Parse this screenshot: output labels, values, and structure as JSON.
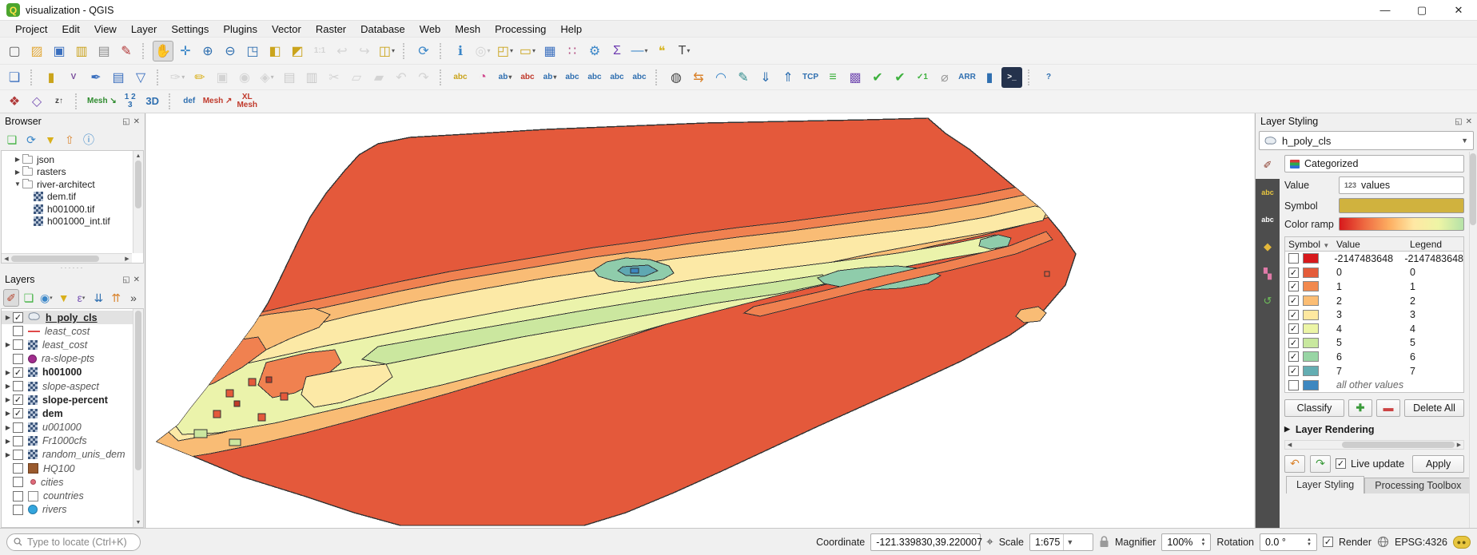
{
  "window": {
    "title": "visualization - QGIS"
  },
  "menu": [
    "Project",
    "Edit",
    "View",
    "Layer",
    "Settings",
    "Plugins",
    "Vector",
    "Raster",
    "Database",
    "Web",
    "Mesh",
    "Processing",
    "Help"
  ],
  "toolbar1": [
    {
      "name": "new-project",
      "glyph": "▢",
      "color": "#5f5f5f"
    },
    {
      "name": "open-project",
      "glyph": "▨",
      "color": "#e2a93b"
    },
    {
      "name": "save-project",
      "glyph": "▣",
      "color": "#3a6fbe"
    },
    {
      "name": "new-print-layout",
      "glyph": "▥",
      "color": "#c9a21d"
    },
    {
      "name": "show-layout-manager",
      "glyph": "▤",
      "color": "#8a8a8a"
    },
    {
      "name": "style-manager",
      "glyph": "✎",
      "color": "#b23737"
    },
    {
      "sep": true
    },
    {
      "name": "pan-map",
      "glyph": "✋",
      "color": "#4a4a4a",
      "active": true
    },
    {
      "name": "pan-to-selection",
      "glyph": "✛",
      "color": "#3a86c8"
    },
    {
      "name": "zoom-in",
      "glyph": "⊕",
      "color": "#2f6fb0"
    },
    {
      "name": "zoom-out",
      "glyph": "⊖",
      "color": "#2f6fb0"
    },
    {
      "name": "zoom-full",
      "glyph": "◳",
      "color": "#2f6fb0"
    },
    {
      "name": "zoom-to-layer",
      "glyph": "◧",
      "color": "#caa41c"
    },
    {
      "name": "zoom-to-selection",
      "glyph": "◩",
      "color": "#caa41c"
    },
    {
      "name": "zoom-native",
      "text": "1:1",
      "color": "#9a9a9a",
      "disabled": true
    },
    {
      "name": "zoom-last",
      "glyph": "↩",
      "color": "#9a9a9a",
      "disabled": true
    },
    {
      "name": "zoom-next",
      "glyph": "↪",
      "color": "#9a9a9a",
      "disabled": true
    },
    {
      "name": "new-map-view",
      "glyph": "◫",
      "color": "#caa41c",
      "caret": true
    },
    {
      "sep": true
    },
    {
      "name": "refresh-map",
      "glyph": "⟳",
      "color": "#3a86c8"
    },
    {
      "sep": true
    },
    {
      "name": "identify-features",
      "glyph": "ℹ",
      "color": "#3a86c8"
    },
    {
      "name": "run-feature-action",
      "glyph": "◎",
      "color": "#9a9a9a",
      "disabled": true,
      "caret": true
    },
    {
      "name": "select-features",
      "glyph": "◰",
      "color": "#caa41c",
      "caret": true
    },
    {
      "name": "deselect-features",
      "glyph": "▭",
      "color": "#caa41c",
      "caret": true
    },
    {
      "name": "open-attribute-table",
      "glyph": "▦",
      "color": "#3a6fbe"
    },
    {
      "name": "field-calculator",
      "glyph": "∷",
      "color": "#b24a7e"
    },
    {
      "name": "processing-options",
      "glyph": "⚙",
      "color": "#3a86c8"
    },
    {
      "name": "statistics-summary",
      "glyph": "Σ",
      "color": "#6d3bb0"
    },
    {
      "name": "measure",
      "glyph": "―",
      "color": "#3a86c8",
      "caret": true
    },
    {
      "name": "map-tips",
      "glyph": "❝",
      "color": "#d8b626"
    },
    {
      "name": "text-annotation",
      "glyph": "T",
      "color": "#444444",
      "caret": true
    }
  ],
  "toolbar2": [
    {
      "name": "data-source-manager",
      "glyph": "❏",
      "color": "#3a6fbe"
    },
    {
      "sep": true
    },
    {
      "name": "new-geopackage-layer",
      "glyph": "▮",
      "color": "#caa41c"
    },
    {
      "name": "new-shapefile-layer",
      "text": "V",
      "color": "#7a4f9d"
    },
    {
      "name": "new-scratch-layer",
      "glyph": "✒",
      "color": "#3a6fbe"
    },
    {
      "name": "new-mesh-layer",
      "glyph": "▤",
      "color": "#3a6fbe"
    },
    {
      "name": "new-gpx-layer",
      "glyph": "▽",
      "color": "#3a6fbe"
    },
    {
      "sep": true
    },
    {
      "name": "current-edits",
      "glyph": "✑",
      "color": "#9a9a9a",
      "disabled": true,
      "caret": true
    },
    {
      "name": "toggle-editing",
      "glyph": "✏",
      "color": "#d9b01c"
    },
    {
      "name": "save-layer-edits",
      "glyph": "▣",
      "color": "#9a9a9a",
      "disabled": true
    },
    {
      "name": "add-feature",
      "glyph": "◉",
      "color": "#9a9a9a",
      "disabled": true
    },
    {
      "name": "vertex-tool",
      "glyph": "◈",
      "color": "#9a9a9a",
      "disabled": true,
      "caret": true
    },
    {
      "name": "modify-attributes",
      "glyph": "▤",
      "color": "#b27777",
      "disabled": true
    },
    {
      "name": "delete-selected",
      "glyph": "▥",
      "color": "#c66a6a",
      "disabled": true
    },
    {
      "name": "cut-features",
      "glyph": "✂",
      "color": "#9a9a9a",
      "disabled": true
    },
    {
      "name": "copy-features",
      "glyph": "▱",
      "color": "#9a9a9a",
      "disabled": true
    },
    {
      "name": "paste-features",
      "glyph": "▰",
      "color": "#9a9a9a",
      "disabled": true
    },
    {
      "name": "undo",
      "glyph": "↶",
      "color": "#9a9a9a",
      "disabled": true
    },
    {
      "name": "redo",
      "glyph": "↷",
      "color": "#9a9a9a",
      "disabled": true
    },
    {
      "sep": true
    },
    {
      "name": "layer-labeling-options",
      "text": "abc",
      "color": "#caa41c"
    },
    {
      "name": "layer-diagram-options",
      "glyph": "◔",
      "color": "#d04a8e"
    },
    {
      "name": "pin-unpin-labels",
      "text": "ab",
      "color": "#2f6fb0",
      "caret": true
    },
    {
      "name": "highlight-unplaced-labels",
      "text": "abc",
      "color": "#c0392b"
    },
    {
      "name": "show-hide-labels",
      "text": "ab",
      "color": "#2f6fb0",
      "caret": true
    },
    {
      "name": "move-label",
      "text": "abc",
      "color": "#2f6fb0"
    },
    {
      "name": "rotate-label",
      "text": "abc",
      "color": "#2f6fb0"
    },
    {
      "name": "change-label-properties",
      "text": "abc",
      "color": "#2f6fb0"
    },
    {
      "name": "label-toolbar-extra",
      "text": "abc",
      "color": "#2f6fb0"
    },
    {
      "sep": true
    },
    {
      "name": "metasearch",
      "glyph": "◍",
      "color": "#444444"
    },
    {
      "name": "swap-styles",
      "glyph": "⇆",
      "color": "#d9822b"
    },
    {
      "name": "spline-tool",
      "glyph": "◠",
      "color": "#3a86c8"
    },
    {
      "name": "sketch-tool",
      "glyph": "✎",
      "color": "#2e8b8b"
    },
    {
      "name": "import-layer",
      "glyph": "⇓",
      "color": "#2f6fb0"
    },
    {
      "name": "export-layer",
      "glyph": "⇑",
      "color": "#2f6fb0"
    },
    {
      "name": "tcp-connection",
      "text": "TCP",
      "color": "#2f6fb0"
    },
    {
      "name": "checklist-tool",
      "glyph": "≡",
      "color": "#3db13d"
    },
    {
      "name": "raster-image-tool",
      "glyph": "▩",
      "color": "#7a55b5"
    },
    {
      "name": "topology-check",
      "glyph": "✔",
      "color": "#3db13d"
    },
    {
      "name": "geometry-check",
      "glyph": "✔",
      "color": "#3db13d"
    },
    {
      "name": "single-check",
      "text": "✓1",
      "color": "#3db13d"
    },
    {
      "name": "ruler-plugin",
      "glyph": "⌀",
      "color": "#9a9a9a"
    },
    {
      "name": "arr-plugin",
      "text": "ARR",
      "color": "#2f6fb0"
    },
    {
      "name": "panel-plugin",
      "glyph": "▮",
      "color": "#2f6fb0"
    },
    {
      "name": "python-console",
      "text": ">_",
      "color": "#ffffff",
      "dark": true
    },
    {
      "sep": true
    },
    {
      "name": "help",
      "text": "?",
      "color": "#2f6fb0"
    }
  ],
  "toolbar3": [
    {
      "name": "mesh-digitizing",
      "glyph": "❖",
      "color": "#b03a3a"
    },
    {
      "name": "mesh-transects",
      "glyph": "◇",
      "color": "#7a55b5"
    },
    {
      "name": "elevation-profile",
      "text": "z↑",
      "color": "#444444"
    },
    {
      "sep": true
    },
    {
      "name": "crayfish-mesh",
      "text": "Mesh ↘",
      "color": "#2e8b2e"
    },
    {
      "name": "mesh-calculator",
      "text": "1 2\n3",
      "color": "#2f6fb0"
    },
    {
      "name": "open-3d-view",
      "text": "3D",
      "color": "#2f6fb0",
      "big": true
    },
    {
      "sep": true
    },
    {
      "name": "def-plugin",
      "text": "def",
      "color": "#2f6fb0"
    },
    {
      "name": "mesh-red-plugin",
      "text": "Mesh ↗",
      "color": "#c0392b"
    },
    {
      "name": "xl-mesh-plugin",
      "text": "XL\nMesh",
      "color": "#c0392b"
    }
  ],
  "browser": {
    "title": "Browser",
    "tools": [
      {
        "name": "browser-add-selected-layers",
        "glyph": "❏",
        "color": "#3db13d"
      },
      {
        "name": "browser-refresh",
        "glyph": "⟳",
        "color": "#3a86c8"
      },
      {
        "name": "browser-filter",
        "glyph": "▼",
        "color": "#d9b01c"
      },
      {
        "name": "browser-collapse-all",
        "glyph": "⇧",
        "color": "#d9822b"
      },
      {
        "name": "browser-properties",
        "glyph": "ⓘ",
        "color": "#3a86c8"
      }
    ],
    "tree": [
      {
        "label": "json",
        "icon": "folder",
        "indent": 1,
        "exp": "▶"
      },
      {
        "label": "rasters",
        "icon": "folder",
        "indent": 1,
        "exp": "▶"
      },
      {
        "label": "river-architect",
        "icon": "folder",
        "indent": 1,
        "exp": "▼"
      },
      {
        "label": "dem.tif",
        "icon": "raster",
        "indent": 2,
        "exp": ""
      },
      {
        "label": "h001000.tif",
        "icon": "raster",
        "indent": 2,
        "exp": ""
      },
      {
        "label": "h001000_int.tif",
        "icon": "raster",
        "indent": 2,
        "exp": ""
      }
    ]
  },
  "layers": {
    "title": "Layers",
    "tools": [
      {
        "name": "open-layer-styling-panel",
        "glyph": "✐",
        "color": "#b5452f",
        "active": true
      },
      {
        "name": "add-group",
        "glyph": "❏",
        "color": "#3db13d"
      },
      {
        "name": "manage-map-themes",
        "glyph": "◉",
        "color": "#3a86c8",
        "caret": true
      },
      {
        "name": "filter-legend",
        "glyph": "▼",
        "color": "#d9b01c"
      },
      {
        "name": "filter-by-expression",
        "glyph": "ε",
        "color": "#7a55b5",
        "caret": true
      },
      {
        "name": "expand-all",
        "glyph": "⇊",
        "color": "#2f6fb0"
      },
      {
        "name": "collapse-all",
        "glyph": "⇈",
        "color": "#d9822b"
      },
      {
        "name": "panel-overflow",
        "glyph": "»",
        "color": "#444444"
      }
    ],
    "items": [
      {
        "name": "h_poly_cls",
        "checked": true,
        "icon": "polygon",
        "bold": true,
        "underline": true,
        "selected": true,
        "arrow": true
      },
      {
        "name": "least_cost",
        "checked": false,
        "icon": "line-red",
        "italic": true,
        "arrow": false
      },
      {
        "name": "least_cost",
        "checked": false,
        "icon": "raster",
        "italic": true,
        "arrow": true
      },
      {
        "name": "ra-slope-pts",
        "checked": false,
        "icon": "point-purple",
        "italic": true,
        "arrow": false
      },
      {
        "name": "h001000",
        "checked": true,
        "icon": "raster",
        "bold": true,
        "arrow": true
      },
      {
        "name": "slope-aspect",
        "checked": false,
        "icon": "raster",
        "italic": true,
        "arrow": true
      },
      {
        "name": "slope-percent",
        "checked": true,
        "icon": "raster",
        "bold": true,
        "arrow": true
      },
      {
        "name": "dem",
        "checked": true,
        "icon": "raster",
        "bold": true,
        "arrow": true
      },
      {
        "name": "u001000",
        "checked": false,
        "icon": "raster",
        "italic": true,
        "arrow": true
      },
      {
        "name": "Fr1000cfs",
        "checked": false,
        "icon": "raster",
        "italic": true,
        "arrow": true
      },
      {
        "name": "random_unis_dem",
        "checked": false,
        "icon": "raster",
        "italic": true,
        "arrow": true
      },
      {
        "name": "HQ100",
        "checked": false,
        "icon": "fill-brown",
        "italic": true,
        "arrow": false
      },
      {
        "name": "cities",
        "checked": false,
        "icon": "point-pink",
        "italic": true,
        "arrow": false
      },
      {
        "name": "countries",
        "checked": false,
        "icon": "fill-white",
        "italic": true,
        "arrow": false
      },
      {
        "name": "rivers",
        "checked": false,
        "icon": "point-blue",
        "italic": true,
        "arrow": false
      }
    ]
  },
  "styling": {
    "title": "Layer Styling",
    "layer": "h_poly_cls",
    "renderer": "Categorized",
    "labels": {
      "value": "Value",
      "symbol": "Symbol",
      "ramp": "Color ramp"
    },
    "value_badge": "123",
    "value_field": "values",
    "symbol_color": "#d0b23e",
    "ramp": [
      "#d7191c",
      "#ee6941",
      "#fdae61",
      "#ffe8a4",
      "#eef5a5",
      "#b5e2a8"
    ],
    "tabs": [
      {
        "name": "symbology-tab",
        "glyph": "✐",
        "color": "#b5452f",
        "active": true
      },
      {
        "name": "labels-tab",
        "text": "abc",
        "color": "#e8c63f"
      },
      {
        "name": "callouts-tab",
        "text": "abc",
        "color": "#ffffff"
      },
      {
        "name": "3d-view-tab",
        "glyph": "◆",
        "color": "#e3b73a"
      },
      {
        "name": "diagrams-tab",
        "glyph": "▚",
        "color": "#e07aa8"
      },
      {
        "name": "history-tab",
        "glyph": "↺",
        "color": "#6fbf5a"
      }
    ],
    "table": {
      "headers": [
        "Symbol",
        "Value",
        "Legend"
      ],
      "rows": [
        {
          "checked": false,
          "color": "#d7191c",
          "value": "-2147483648",
          "legend": "-2147483648"
        },
        {
          "checked": true,
          "color": "#e45c3a",
          "value": "0",
          "legend": "0"
        },
        {
          "checked": true,
          "color": "#f2894e",
          "value": "1",
          "legend": "1"
        },
        {
          "checked": true,
          "color": "#fbbd74",
          "value": "2",
          "legend": "2"
        },
        {
          "checked": true,
          "color": "#fee8a0",
          "value": "3",
          "legend": "3"
        },
        {
          "checked": true,
          "color": "#ecf5a6",
          "value": "4",
          "legend": "4"
        },
        {
          "checked": true,
          "color": "#c8e89e",
          "value": "5",
          "legend": "5"
        },
        {
          "checked": true,
          "color": "#98d5a4",
          "value": "6",
          "legend": "6"
        },
        {
          "checked": true,
          "color": "#63adb2",
          "value": "7",
          "legend": "7"
        },
        {
          "checked": false,
          "color": "#3d87c0",
          "value": "all other values",
          "legend": "",
          "italic": true
        }
      ]
    },
    "buttons": {
      "classify": "Classify",
      "add": "✚",
      "remove": "▬",
      "delete_all": "Delete All"
    },
    "layer_rendering": "Layer Rendering",
    "live_update": "Live update",
    "apply": "Apply"
  },
  "bottom_tabs": [
    {
      "label": "Layer Styling",
      "active": true
    },
    {
      "label": "Processing Toolbox",
      "active": false
    }
  ],
  "statusbar": {
    "locate_placeholder": "Type to locate (Ctrl+K)",
    "coordinate_label": "Coordinate",
    "coordinate": "-121.339830,39.220007",
    "scale_label": "Scale",
    "scale": "1:675",
    "magnifier_label": "Magnifier",
    "magnifier": "100%",
    "rotation_label": "Rotation",
    "rotation": "0.0 °",
    "render_label": "Render",
    "crs": "EPSG:4326"
  },
  "map_colors": {
    "c0": "#e4593b",
    "c0dark": "#c23b28",
    "c1": "#f08150",
    "c2": "#f9bc75",
    "c3": "#fce9a6",
    "c4": "#ebf3ab",
    "c5": "#cbe79f",
    "c6": "#8fccab",
    "c7": "#5fa8b2",
    "cOther": "#3d87c0",
    "outline": "#333333"
  }
}
